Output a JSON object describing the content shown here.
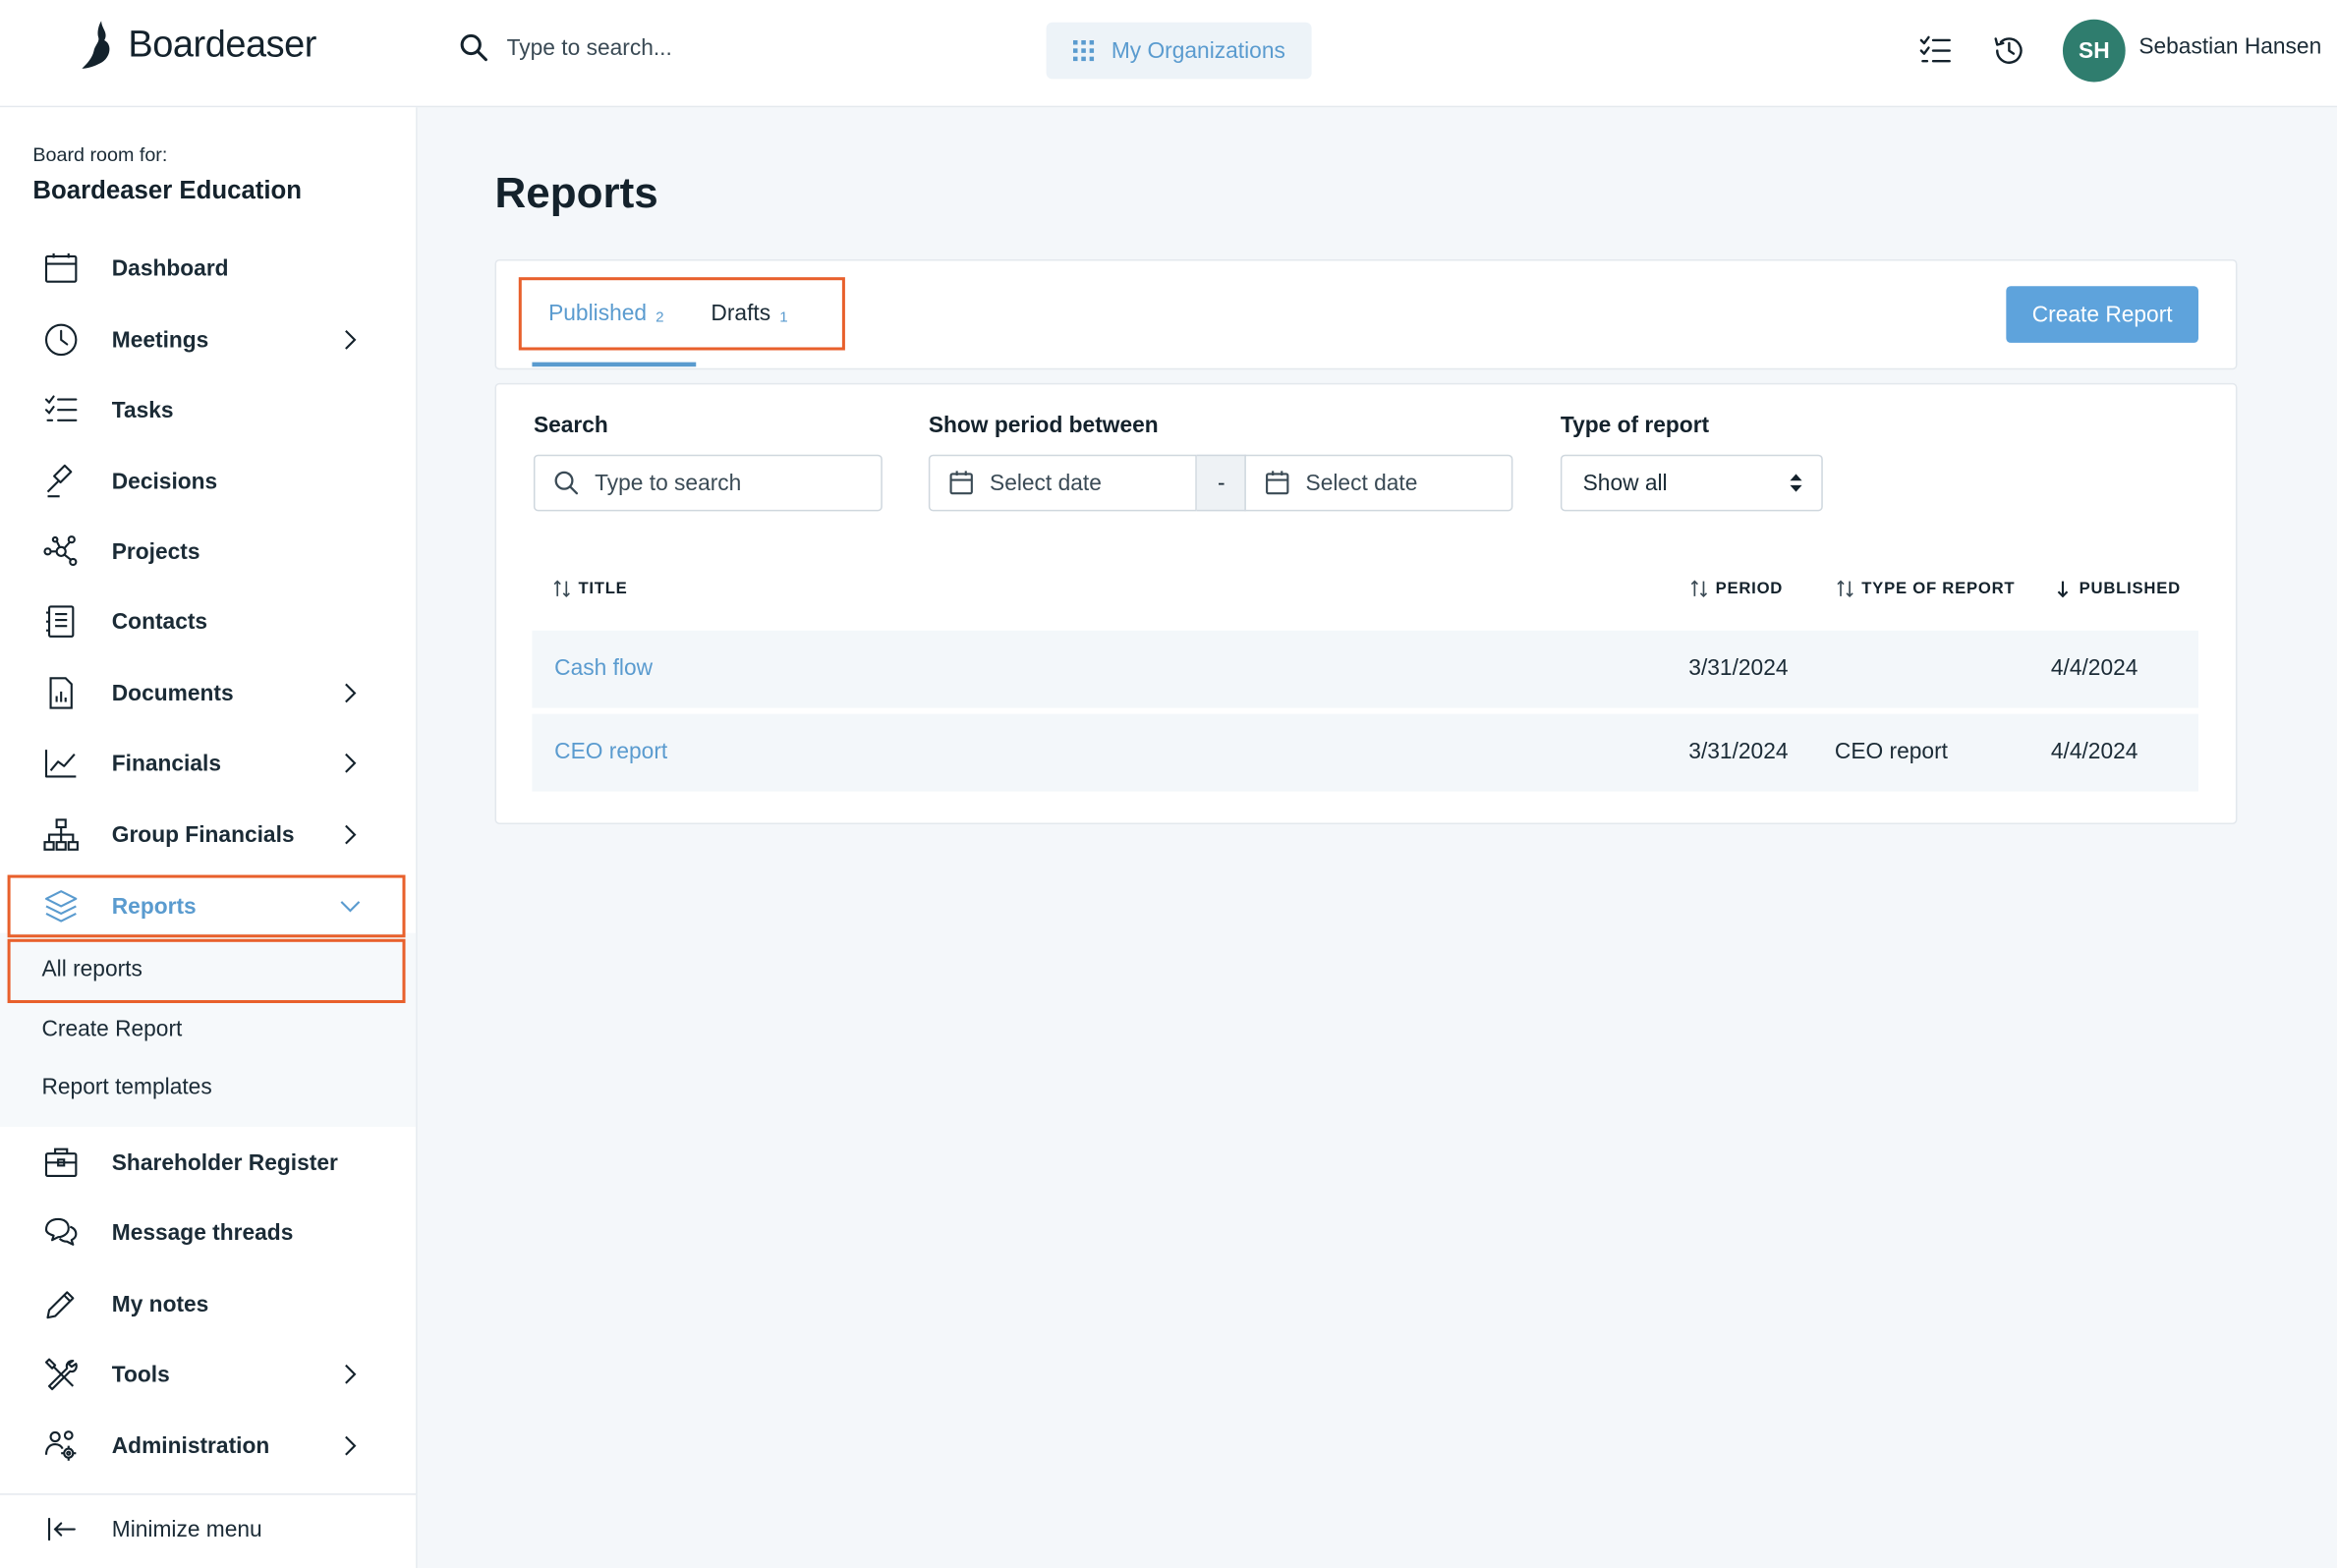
{
  "app": {
    "name": "Boardeaser",
    "search_placeholder": "Type to search...",
    "org_button": "My Organizations",
    "user": {
      "initials": "SH",
      "name": "Sebastian Hansen"
    },
    "colors": {
      "accent": "#5a9bcf",
      "highlight": "#e8602c",
      "avatar": "#2f7d6e"
    }
  },
  "sidebar": {
    "board_label": "Board room for:",
    "board_name": "Boardeaser Education",
    "items": [
      {
        "label": "Dashboard",
        "icon": "calendar-window-icon"
      },
      {
        "label": "Meetings",
        "icon": "clock-icon"
      },
      {
        "label": "Tasks",
        "icon": "checklist-icon"
      },
      {
        "label": "Decisions",
        "icon": "gavel-icon"
      },
      {
        "label": "Projects",
        "icon": "network-icon"
      },
      {
        "label": "Contacts",
        "icon": "address-book-icon"
      },
      {
        "label": "Documents",
        "icon": "document-chart-icon"
      },
      {
        "label": "Financials",
        "icon": "line-chart-icon"
      },
      {
        "label": "Group Financials",
        "icon": "org-chart-icon"
      },
      {
        "label": "Reports",
        "icon": "layers-icon"
      },
      {
        "label": "Shareholder Register",
        "icon": "briefcase-icon"
      },
      {
        "label": "Message threads",
        "icon": "chat-bubbles-icon"
      },
      {
        "label": "My notes",
        "icon": "pencil-icon"
      },
      {
        "label": "Tools",
        "icon": "tools-icon"
      },
      {
        "label": "Administration",
        "icon": "users-gear-icon"
      }
    ],
    "reports_sub": [
      "All reports",
      "Create Report",
      "Report templates"
    ],
    "minimize": "Minimize menu"
  },
  "main": {
    "title": "Reports",
    "tabs": [
      {
        "label": "Published",
        "count": "2"
      },
      {
        "label": "Drafts",
        "count": "1"
      }
    ],
    "create_button": "Create Report",
    "filters": {
      "search_label": "Search",
      "search_placeholder": "Type to search",
      "period_label": "Show period between",
      "date_placeholder": "Select date",
      "date_separator": "-",
      "type_label": "Type of report",
      "type_value": "Show all"
    },
    "table": {
      "headers": [
        "TITLE",
        "PERIOD",
        "TYPE OF REPORT",
        "PUBLISHED"
      ],
      "rows": [
        {
          "title": "Cash flow",
          "period": "3/31/2024",
          "type": "",
          "published": "4/4/2024"
        },
        {
          "title": "CEO report",
          "period": "3/31/2024",
          "type": "CEO report",
          "published": "4/4/2024"
        }
      ]
    }
  }
}
